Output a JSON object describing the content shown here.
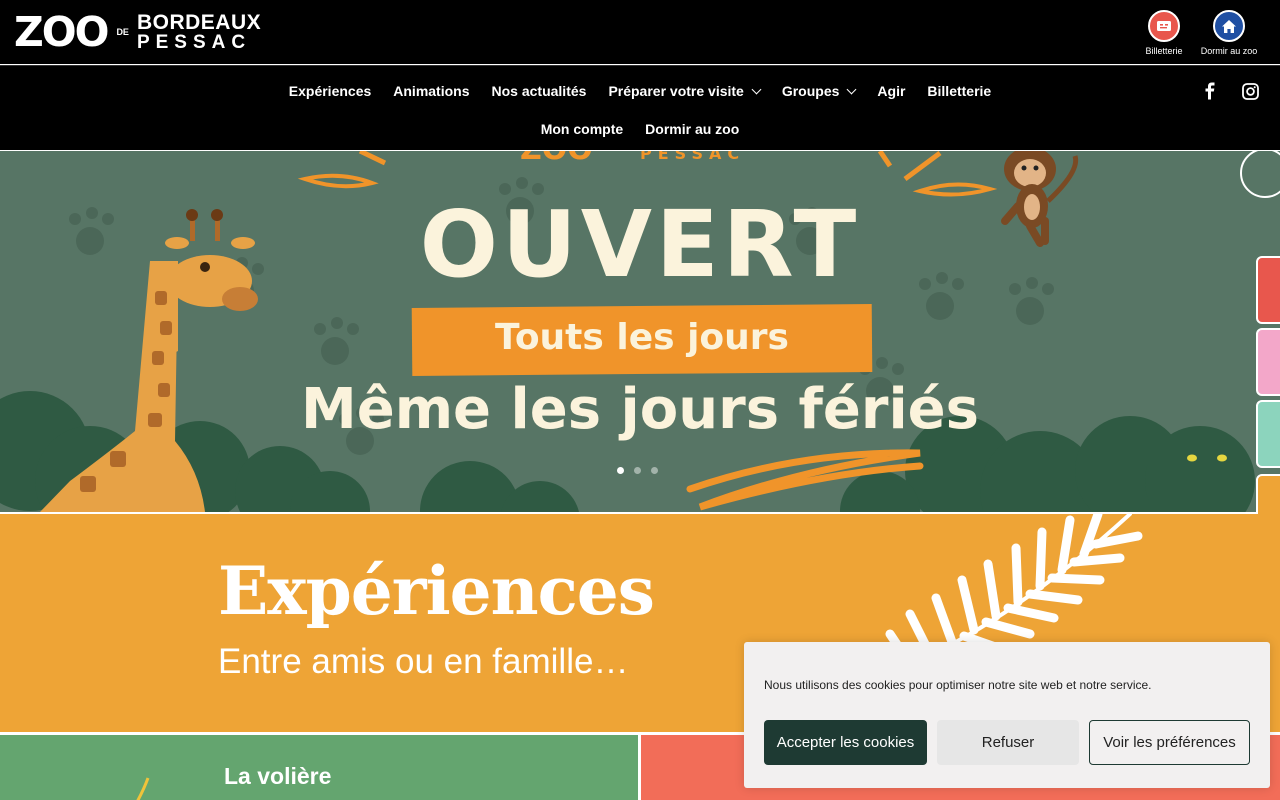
{
  "header": {
    "logo": {
      "zoo": "ZOO",
      "de": "DE",
      "line1": "BORDEAUX",
      "line2": "PESSAC"
    },
    "quick_links": [
      {
        "label": "Billetterie",
        "icon": "ticket-icon",
        "color": "#e8574d"
      },
      {
        "label": "Dormir au zoo",
        "icon": "home-icon",
        "color": "#1f4fa3"
      }
    ]
  },
  "nav": {
    "row1": [
      {
        "label": "Expériences"
      },
      {
        "label": "Animations"
      },
      {
        "label": "Nos actualités"
      },
      {
        "label": "Préparer votre visite",
        "dropdown": true
      },
      {
        "label": "Groupes",
        "dropdown": true
      },
      {
        "label": "Agir"
      },
      {
        "label": "Billetterie"
      }
    ],
    "row2": [
      {
        "label": "Mon compte"
      },
      {
        "label": "Dormir au zoo"
      }
    ],
    "social": [
      "facebook-icon",
      "instagram-icon"
    ]
  },
  "hero": {
    "headline": "OUVERT",
    "band_text": "Touts les jours",
    "subline": "Même les jours fériés",
    "slides": 3,
    "active_slide": 1,
    "background_color": "#577565",
    "accent_color": "#f0942a"
  },
  "side_tabs": {
    "colors": [
      "#e8574d",
      "#f3a7c9",
      "#8cd4bd",
      "#eea436"
    ]
  },
  "experiences": {
    "title": "Expériences",
    "subtitle": "Entre amis ou en famille…",
    "background_color": "#eea436"
  },
  "cards": [
    {
      "title": "La volière",
      "color": "#64a56f"
    },
    {
      "title": "",
      "color": "#f26d58"
    }
  ],
  "cookie_banner": {
    "message": "Nous utilisons des cookies pour optimiser notre site web et notre service.",
    "accept_label": "Accepter les cookies",
    "refuse_label": "Refuser",
    "prefs_label": "Voir les préférences"
  }
}
